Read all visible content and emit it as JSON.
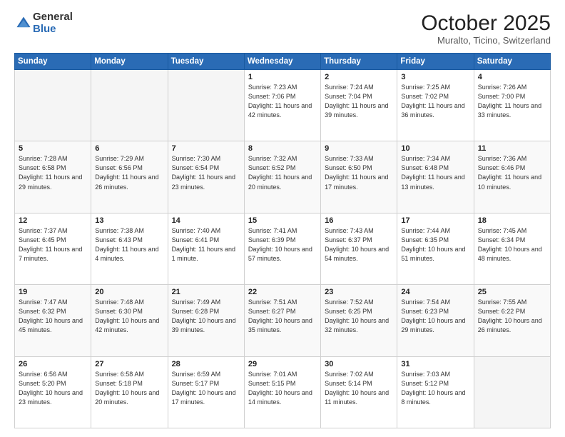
{
  "logo": {
    "general": "General",
    "blue": "Blue"
  },
  "title": "October 2025",
  "location": "Muralto, Ticino, Switzerland",
  "days_of_week": [
    "Sunday",
    "Monday",
    "Tuesday",
    "Wednesday",
    "Thursday",
    "Friday",
    "Saturday"
  ],
  "weeks": [
    [
      {
        "day": "",
        "info": ""
      },
      {
        "day": "",
        "info": ""
      },
      {
        "day": "",
        "info": ""
      },
      {
        "day": "1",
        "info": "Sunrise: 7:23 AM\nSunset: 7:06 PM\nDaylight: 11 hours and 42 minutes."
      },
      {
        "day": "2",
        "info": "Sunrise: 7:24 AM\nSunset: 7:04 PM\nDaylight: 11 hours and 39 minutes."
      },
      {
        "day": "3",
        "info": "Sunrise: 7:25 AM\nSunset: 7:02 PM\nDaylight: 11 hours and 36 minutes."
      },
      {
        "day": "4",
        "info": "Sunrise: 7:26 AM\nSunset: 7:00 PM\nDaylight: 11 hours and 33 minutes."
      }
    ],
    [
      {
        "day": "5",
        "info": "Sunrise: 7:28 AM\nSunset: 6:58 PM\nDaylight: 11 hours and 29 minutes."
      },
      {
        "day": "6",
        "info": "Sunrise: 7:29 AM\nSunset: 6:56 PM\nDaylight: 11 hours and 26 minutes."
      },
      {
        "day": "7",
        "info": "Sunrise: 7:30 AM\nSunset: 6:54 PM\nDaylight: 11 hours and 23 minutes."
      },
      {
        "day": "8",
        "info": "Sunrise: 7:32 AM\nSunset: 6:52 PM\nDaylight: 11 hours and 20 minutes."
      },
      {
        "day": "9",
        "info": "Sunrise: 7:33 AM\nSunset: 6:50 PM\nDaylight: 11 hours and 17 minutes."
      },
      {
        "day": "10",
        "info": "Sunrise: 7:34 AM\nSunset: 6:48 PM\nDaylight: 11 hours and 13 minutes."
      },
      {
        "day": "11",
        "info": "Sunrise: 7:36 AM\nSunset: 6:46 PM\nDaylight: 11 hours and 10 minutes."
      }
    ],
    [
      {
        "day": "12",
        "info": "Sunrise: 7:37 AM\nSunset: 6:45 PM\nDaylight: 11 hours and 7 minutes."
      },
      {
        "day": "13",
        "info": "Sunrise: 7:38 AM\nSunset: 6:43 PM\nDaylight: 11 hours and 4 minutes."
      },
      {
        "day": "14",
        "info": "Sunrise: 7:40 AM\nSunset: 6:41 PM\nDaylight: 11 hours and 1 minute."
      },
      {
        "day": "15",
        "info": "Sunrise: 7:41 AM\nSunset: 6:39 PM\nDaylight: 10 hours and 57 minutes."
      },
      {
        "day": "16",
        "info": "Sunrise: 7:43 AM\nSunset: 6:37 PM\nDaylight: 10 hours and 54 minutes."
      },
      {
        "day": "17",
        "info": "Sunrise: 7:44 AM\nSunset: 6:35 PM\nDaylight: 10 hours and 51 minutes."
      },
      {
        "day": "18",
        "info": "Sunrise: 7:45 AM\nSunset: 6:34 PM\nDaylight: 10 hours and 48 minutes."
      }
    ],
    [
      {
        "day": "19",
        "info": "Sunrise: 7:47 AM\nSunset: 6:32 PM\nDaylight: 10 hours and 45 minutes."
      },
      {
        "day": "20",
        "info": "Sunrise: 7:48 AM\nSunset: 6:30 PM\nDaylight: 10 hours and 42 minutes."
      },
      {
        "day": "21",
        "info": "Sunrise: 7:49 AM\nSunset: 6:28 PM\nDaylight: 10 hours and 39 minutes."
      },
      {
        "day": "22",
        "info": "Sunrise: 7:51 AM\nSunset: 6:27 PM\nDaylight: 10 hours and 35 minutes."
      },
      {
        "day": "23",
        "info": "Sunrise: 7:52 AM\nSunset: 6:25 PM\nDaylight: 10 hours and 32 minutes."
      },
      {
        "day": "24",
        "info": "Sunrise: 7:54 AM\nSunset: 6:23 PM\nDaylight: 10 hours and 29 minutes."
      },
      {
        "day": "25",
        "info": "Sunrise: 7:55 AM\nSunset: 6:22 PM\nDaylight: 10 hours and 26 minutes."
      }
    ],
    [
      {
        "day": "26",
        "info": "Sunrise: 6:56 AM\nSunset: 5:20 PM\nDaylight: 10 hours and 23 minutes."
      },
      {
        "day": "27",
        "info": "Sunrise: 6:58 AM\nSunset: 5:18 PM\nDaylight: 10 hours and 20 minutes."
      },
      {
        "day": "28",
        "info": "Sunrise: 6:59 AM\nSunset: 5:17 PM\nDaylight: 10 hours and 17 minutes."
      },
      {
        "day": "29",
        "info": "Sunrise: 7:01 AM\nSunset: 5:15 PM\nDaylight: 10 hours and 14 minutes."
      },
      {
        "day": "30",
        "info": "Sunrise: 7:02 AM\nSunset: 5:14 PM\nDaylight: 10 hours and 11 minutes."
      },
      {
        "day": "31",
        "info": "Sunrise: 7:03 AM\nSunset: 5:12 PM\nDaylight: 10 hours and 8 minutes."
      },
      {
        "day": "",
        "info": ""
      }
    ]
  ]
}
